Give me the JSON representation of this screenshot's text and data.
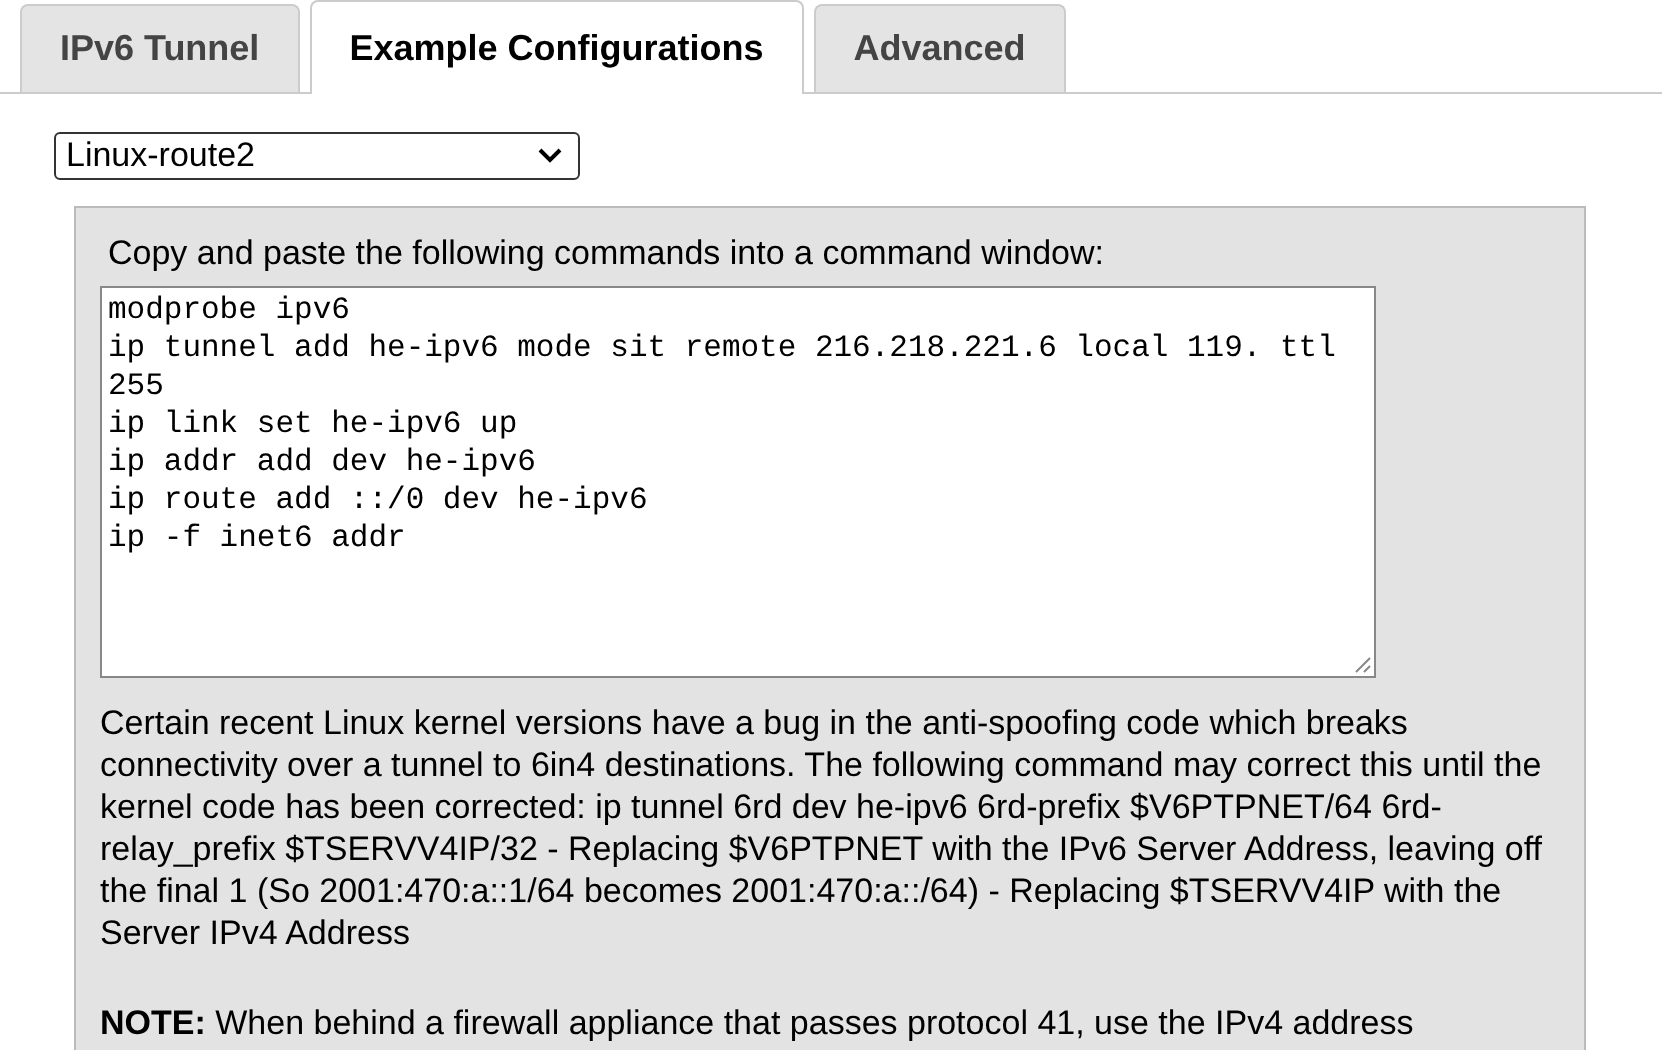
{
  "tabs": [
    {
      "label": "IPv6 Tunnel",
      "selected": false
    },
    {
      "label": "Example Configurations",
      "selected": true
    },
    {
      "label": "Advanced",
      "selected": false
    }
  ],
  "config_select": {
    "value": "Linux-route2"
  },
  "panel": {
    "instruction": "Copy and paste the following commands into a command window:",
    "commands": [
      "modprobe ipv6",
      "ip tunnel add he-ipv6 mode sit remote 216.218.221.6 local 119. ttl 255",
      "ip link set he-ipv6 up",
      "ip addr add dev he-ipv6",
      "ip route add ::/0 dev he-ipv6",
      "ip -f inet6 addr"
    ],
    "note": "Certain recent Linux kernel versions have a bug in the anti-spoofing code which breaks connectivity over a tunnel to 6in4 destinations. The following command may correct this until the kernel code has been corrected: ip tunnel 6rd dev he-ipv6 6rd-prefix $V6PTPNET/64 6rd-relay_prefix $TSERVV4IP/32 - Replacing $V6PTPNET with the IPv6 Server Address, leaving off the final 1 (So 2001:470:a::1/64 becomes 2001:470:a::/64) - Replacing $TSERVV4IP with the Server IPv4 Address",
    "firewall_note": "**NOTE:** When behind a firewall appliance that passes protocol 41, use the IPv4 address"
  }
}
